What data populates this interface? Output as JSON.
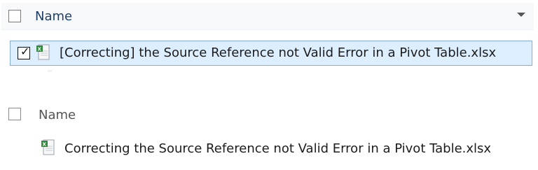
{
  "top_panel": {
    "header": {
      "column_label": "Name"
    },
    "selected_row": {
      "checked": true,
      "file_name": "[Correcting] the Source Reference not Valid Error in a Pivot Table.xlsx",
      "icon": "excel-file-icon"
    }
  },
  "bottom_panel": {
    "header": {
      "column_label": "Name"
    },
    "row": {
      "file_name": "Correcting the Source Reference not Valid Error in a Pivot Table.xlsx",
      "icon": "excel-file-icon"
    }
  },
  "colors": {
    "selection_bg": "#ddeeff",
    "selection_border": "#84acdd",
    "header_text": "#1f3f68"
  }
}
